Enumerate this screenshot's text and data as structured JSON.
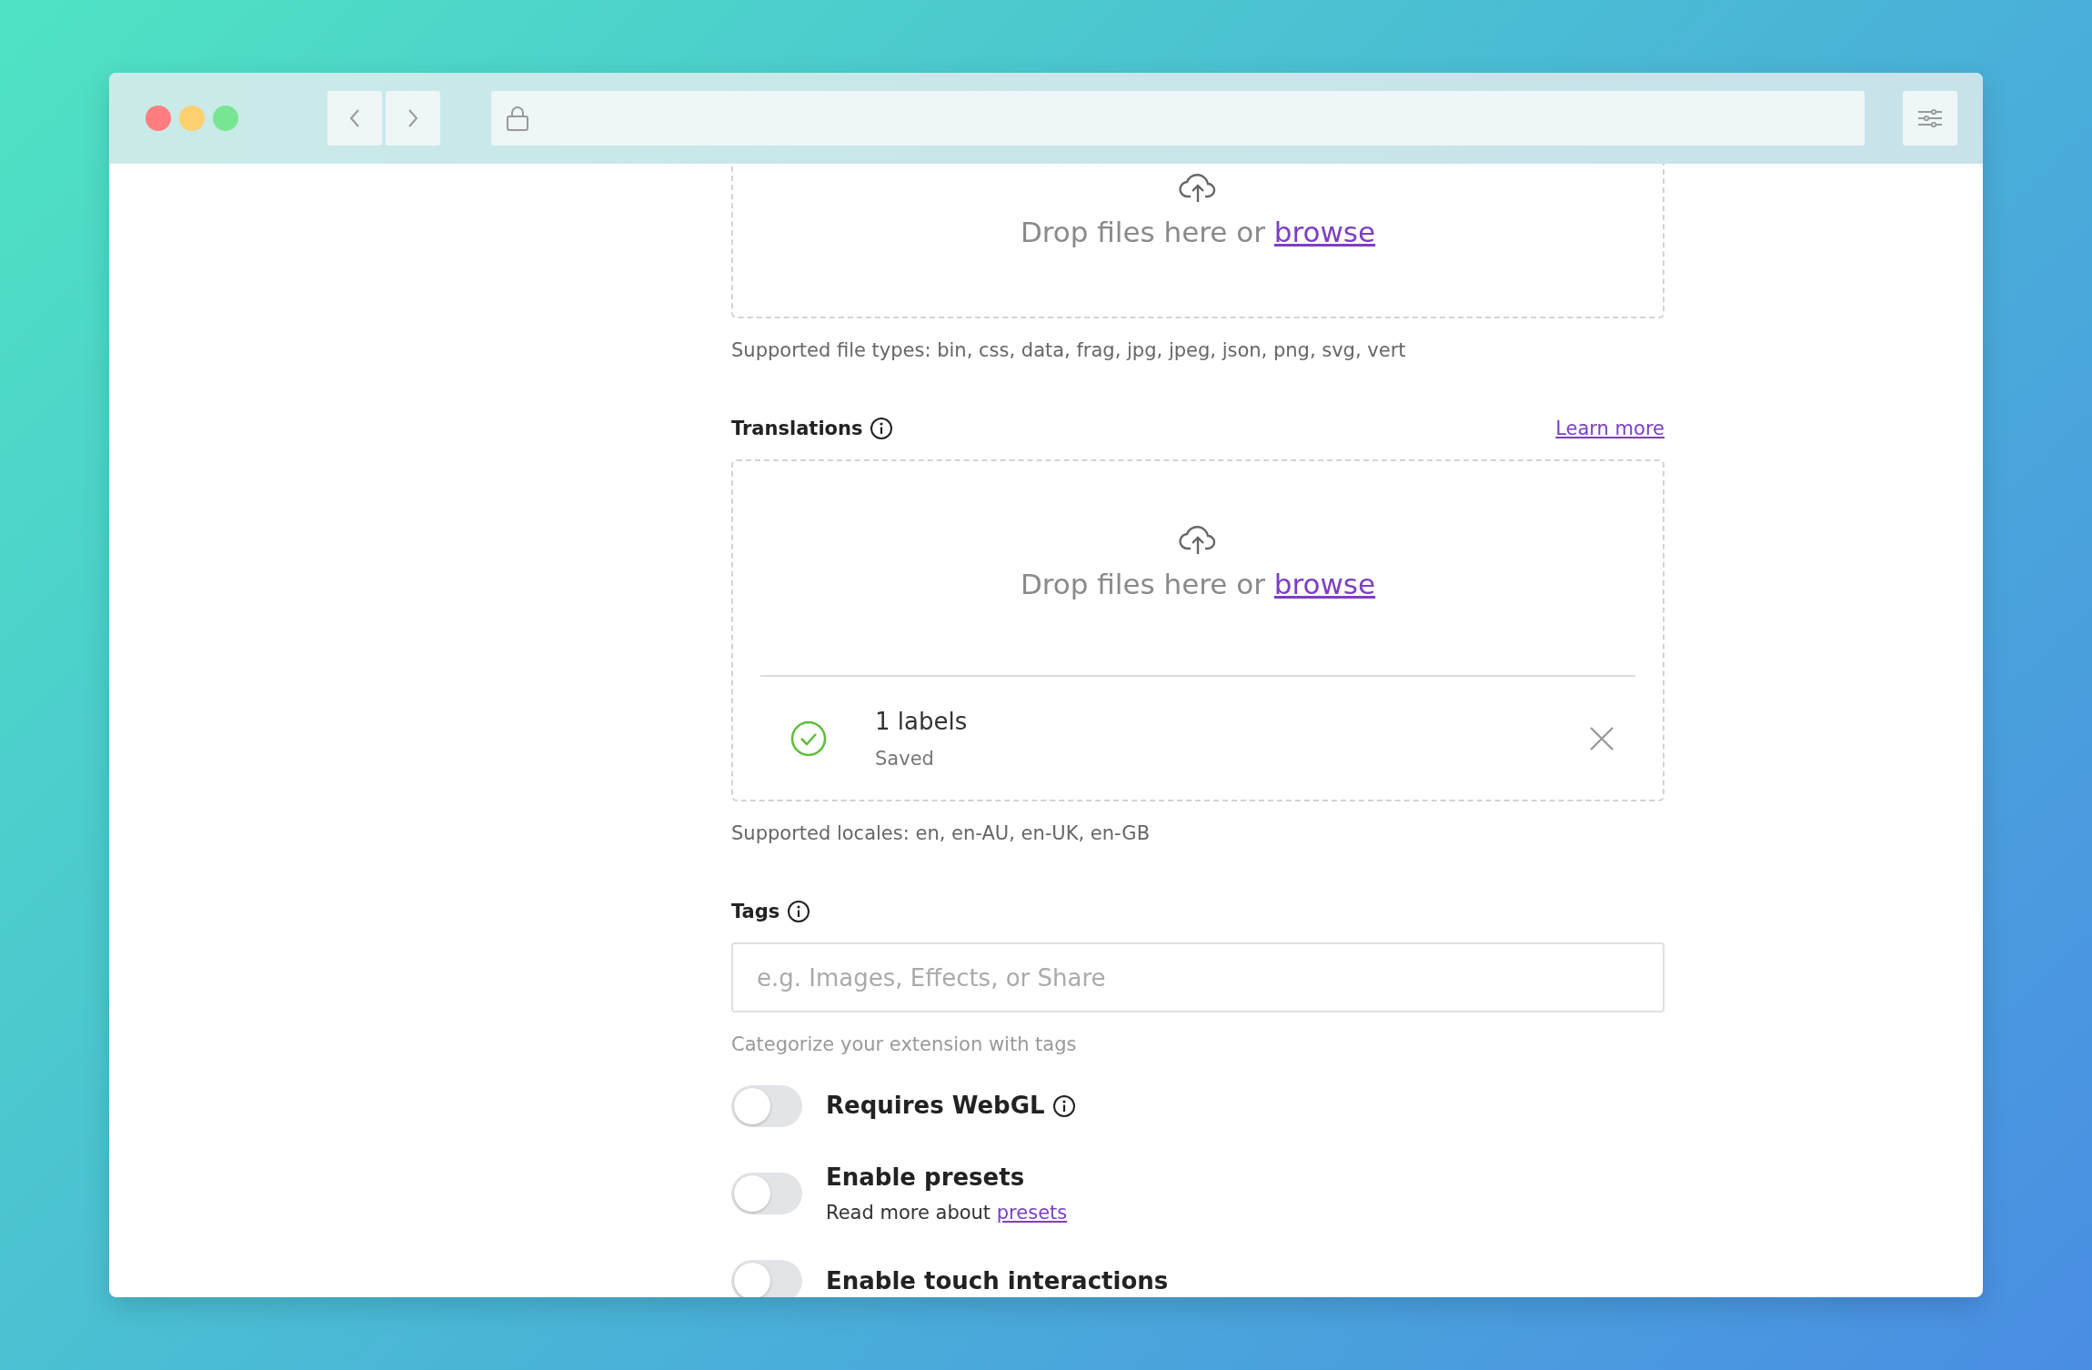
{
  "uploads": [
    {
      "drop_text": "Drop files here or",
      "browse_link": "browse",
      "hint": "Supported file types: bin, css, data, frag, jpg, jpeg, json, png, svg, vert"
    },
    {
      "label": "Translations",
      "learn_more": "Learn more",
      "drop_text": "Drop files here or",
      "browse_link": "browse",
      "files": [
        {
          "name": "1 labels",
          "status": "Saved"
        }
      ],
      "hint": "Supported locales: en, en-AU, en-UK, en-GB"
    }
  ],
  "tags": {
    "label": "Tags",
    "placeholder": "e.g. Images, Effects, or Share",
    "hint": "Categorize your extension with tags"
  },
  "toggles": [
    {
      "label": "Requires WebGL",
      "info": true,
      "on": false
    },
    {
      "label": "Enable presets",
      "info": false,
      "on": false,
      "description": "Read more about",
      "link": "presets"
    },
    {
      "label": "Enable touch interactions",
      "info": false,
      "on": false
    }
  ]
}
